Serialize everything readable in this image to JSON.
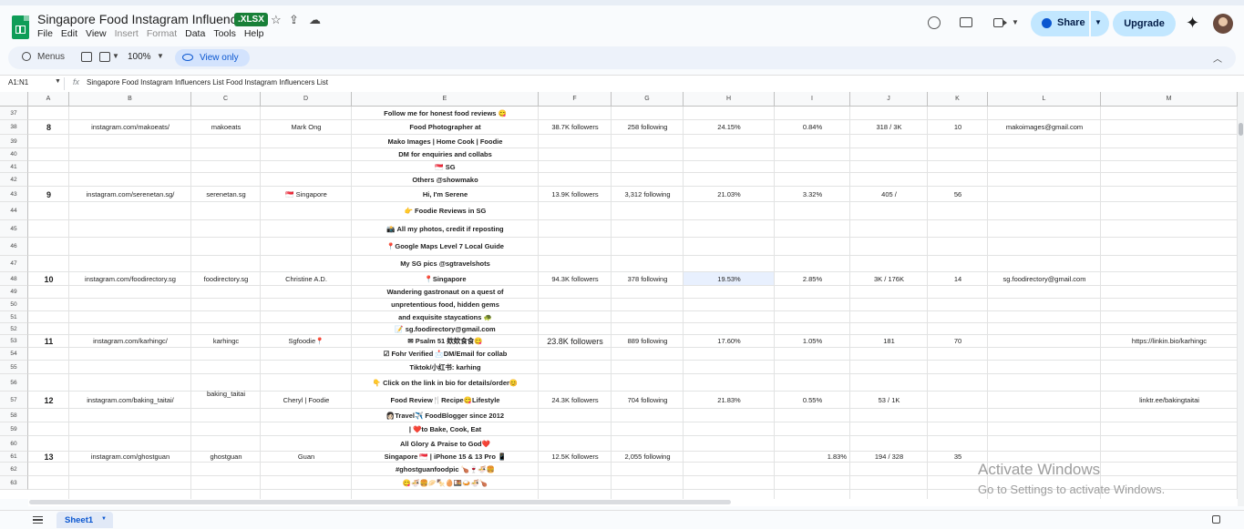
{
  "doc": {
    "title": "Singapore Food Instagram Influencers",
    "badge": ".XLSX"
  },
  "menu": [
    "File",
    "Edit",
    "View",
    "Insert",
    "Format",
    "Data",
    "Tools",
    "Help"
  ],
  "menu_disabled": [
    "Insert",
    "Format"
  ],
  "header_buttons": {
    "share": "Share",
    "upgrade": "Upgrade"
  },
  "toolbar": {
    "menus": "Menus",
    "zoom": "100%",
    "view_only": "View only"
  },
  "formula_bar": {
    "name_box": "A1:N1",
    "fx": "fx",
    "content": "Singapore Food Instagram Influencers List Food Instagram Influencers List"
  },
  "columns": [
    "A",
    "B",
    "C",
    "D",
    "E",
    "F",
    "G",
    "H",
    "I",
    "J",
    "K",
    "L",
    "M"
  ],
  "rows": [
    "37",
    "38",
    "39",
    "40",
    "41",
    "42",
    "43",
    "44",
    "45",
    "46",
    "47",
    "48",
    "49",
    "50",
    "51",
    "52",
    "53",
    "54",
    "55",
    "56",
    "57",
    "58",
    "59",
    "60",
    "61",
    "62",
    "63"
  ],
  "cells": {
    "e37": "Follow me for honest food reviews 😋",
    "a38": "8",
    "b38": "instagram.com/makoeats/",
    "c38": "makoeats",
    "d38": "Mark Ong",
    "e38": "Food Photographer at",
    "f38": "38.7K followers",
    "g38": "258 following",
    "h38": "24.15%",
    "i38": "0.84%",
    "j38": "318 / 3K",
    "k38": "10",
    "l38": "makoimages@gmail.com",
    "e39": "Mako Images | Home Cook | Foodie",
    "e40": "DM for enquiries and collabs",
    "e41": "🇸🇬 SG",
    "e42": "Others @showmako",
    "e43": "Hi, I'm Serene",
    "a43": "9",
    "b43": "instagram.com/serenetan.sg/",
    "c43": "serenetan.sg",
    "d43": "🇸🇬 Singapore",
    "f43": "13.9K followers",
    "g43": "3,312 following",
    "h43": "21.03%",
    "i43": "3.32%",
    "j43": "405 /",
    "k43": "56",
    "e44": "👉 Foodie Reviews in SG",
    "e45": "📸 All my photos, credit if reposting",
    "e46": "📍Google Maps Level 7 Local Guide",
    "e47": "My SG pics @sgtravelshots",
    "a48": "10",
    "b48": "instagram.com/foodirectory.sg",
    "c48": "foodirectory.sg",
    "d48": "Christine A.D.",
    "e48": "📍Singapore",
    "f48": "94.3K followers",
    "g48": "378 following",
    "h48": "19.53%",
    "i48": "2.85%",
    "j48": "3K / 176K",
    "k48": "14",
    "l48": "sg.foodirectory@gmail.com",
    "e49": "Wandering gastronaut on a quest of",
    "e50": "unpretentious food, hidden gems",
    "e51": "and exquisite staycations 🐢",
    "e52": "📝 sg.foodirectory@gmail.com",
    "a53": "11",
    "b53": "instagram.com/karhingc/",
    "c53": "karhingc",
    "d53": "Sgfoodie📍",
    "e53": "✉ Psalm 51 欸欸食食😋",
    "f53": "23.8K followers",
    "g53": "889 following",
    "h53": "17.60%",
    "i53": "1.05%",
    "j53": "181",
    "k53": "70",
    "m53": "https://linkin.bio/karhingc",
    "e54": "☑ Fohr Verified 📩DM/Email for collab",
    "e55": "Tiktok/小红书: karhing",
    "e56": "👇 Click on the link in bio for details/order😊",
    "c56": "baking_taitai",
    "a57": "12",
    "b57": "instagram.com/baking_taitai/",
    "d57": "Cheryl | Foodie",
    "e57": "Food Review🍴Recipe😋Lifestyle",
    "f57": "24.3K followers",
    "g57": "704 following",
    "h57": "21.83%",
    "i57": "0.55%",
    "j57": "53 / 1K",
    "m57": "linktr.ee/bakingtaitai",
    "e58": "👩🏻Travel✈️ FoodBlogger since 2012",
    "e59": "| ❤️to Bake, Cook, Eat",
    "e60": "All Glory & Praise to God❤️",
    "a61": "13",
    "b61": "instagram.com/ghostguan",
    "c61": "ghostguan",
    "d61": "Guan",
    "e61": "Singapore 🇸🇬 | iPhone 15 & 13 Pro 📱",
    "f61": "12.5K followers",
    "g61": "2,055 following",
    "i61": "1.83%",
    "j61": "194 / 328",
    "k61": "35",
    "e62": "#ghostguanfoodpic 🍗🍷🍜🍔",
    "e63": "😋🍜🍔🥟🍢🥚🍱🍛🍜🍗"
  },
  "sheet_tab": "Sheet1",
  "watermark": {
    "line1": "Activate Windows",
    "line2": "Go to Settings to activate Windows."
  },
  "colors": {
    "accent": "#0b57d0",
    "share_bg": "#c2e7ff",
    "sheets_green": "#0f9d58",
    "xlsx_badge": "#188038"
  }
}
